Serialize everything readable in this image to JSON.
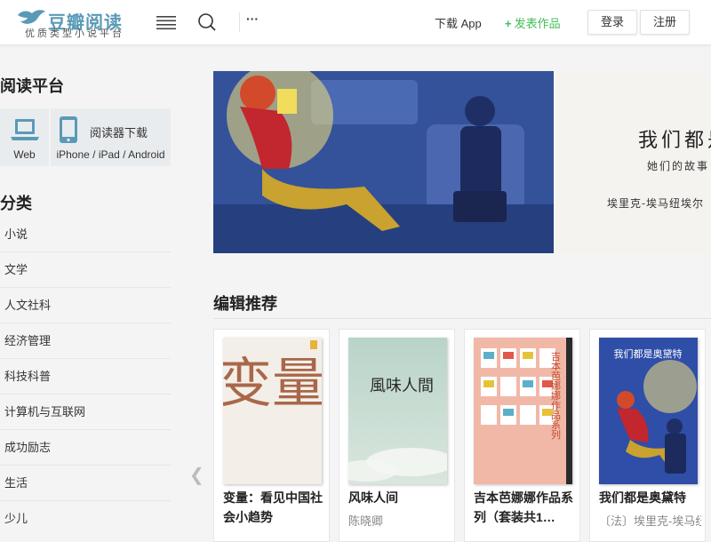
{
  "brand": {
    "name": "豆瓣阅读",
    "tagline": "优质类型小说平台",
    "color": "#5a9ab7"
  },
  "header": {
    "menu_icon": "hamburger-menu-icon",
    "search_icon": "search-icon",
    "more_label": "···",
    "download_app": "下载 App",
    "publish_plus": "+",
    "publish_label": "发表作品",
    "publish_color": "#42bd56",
    "login_label": "登录",
    "register_label": "注册"
  },
  "sidebar": {
    "platform_title": "阅读平台",
    "platforms": [
      {
        "label": "Web",
        "icon": "laptop-icon"
      },
      {
        "label": "阅读器下载",
        "sub": "iPhone / iPad / Android",
        "icon": "phone-icon"
      }
    ],
    "category_title": "分类",
    "categories": [
      "小说",
      "文学",
      "人文社科",
      "经济管理",
      "科技科普",
      "计算机与互联网",
      "成功励志",
      "生活",
      "少儿"
    ]
  },
  "banner": {
    "title": "我们都是",
    "subtitle": "她们的故事",
    "author": "埃里克-埃马纽埃尔"
  },
  "picks": {
    "title": "编辑推荐",
    "books": [
      {
        "title": "变量：看见中国社会小趋势",
        "author": "",
        "cover_text": "变量",
        "cover_color": "#f3efe8"
      },
      {
        "title": "风味人间",
        "author": "陈晓卿",
        "cover_text": "風味人間",
        "cover_color": "#b9d4c8"
      },
      {
        "title": "吉本芭娜娜作品系列（套装共1…",
        "author": "",
        "cover_text": "吉本芭娜娜作品系列",
        "cover_color": "#f1b8a8"
      },
      {
        "title": "我们都是奥黛特",
        "author": "〔法〕埃里克-埃马纽埃尔·施米特",
        "cover_text": "我们都是奥黛特",
        "cover_color": "#2f4ea8"
      }
    ]
  },
  "nav": {
    "prev_icon": "chevron-left-icon",
    "prev_glyph": "❮"
  }
}
